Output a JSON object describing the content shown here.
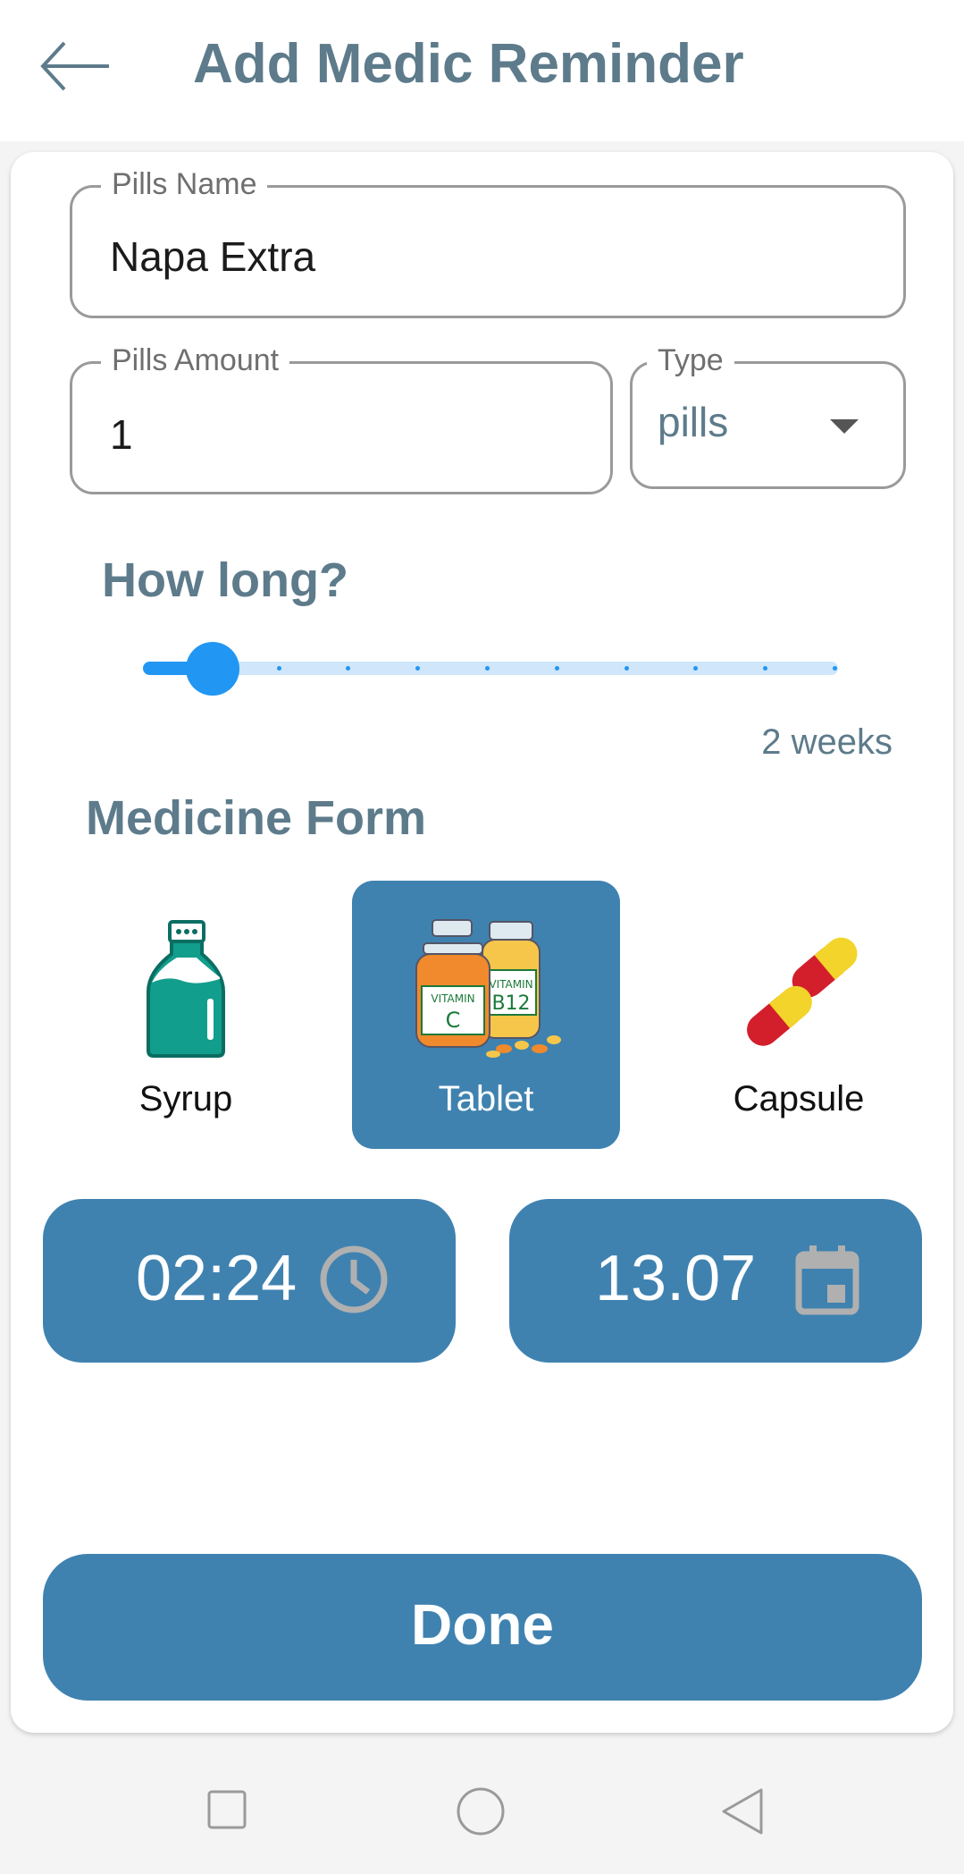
{
  "header": {
    "title": "Add Medic Reminder",
    "back_icon": "arrow-left-icon"
  },
  "pills_name": {
    "label": "Pills Name",
    "value": "Napa Extra"
  },
  "pills_amount": {
    "label": "Pills Amount",
    "value": "1"
  },
  "type": {
    "label": "Type",
    "value": "pills",
    "icon": "dropdown-arrow-icon"
  },
  "duration": {
    "heading": "How long?",
    "value_text": "2 weeks",
    "slider_fraction": 0.1,
    "slider_steps": 10
  },
  "medicine_form": {
    "heading": "Medicine Form",
    "selected": "Tablet",
    "options": [
      {
        "label": "Syrup",
        "icon": "syrup-bottle-icon"
      },
      {
        "label": "Tablet",
        "icon": "vitamin-bottles-icon"
      },
      {
        "label": "Capsule",
        "icon": "capsule-icon"
      }
    ]
  },
  "time": {
    "value": "02:24",
    "icon": "clock-icon"
  },
  "date": {
    "value": "13.07",
    "icon": "calendar-icon"
  },
  "done_label": "Done",
  "navbar": {
    "icons": [
      "square-recents-icon",
      "circle-home-icon",
      "triangle-back-icon"
    ]
  },
  "colors": {
    "accent": "#3f82b0",
    "title": "#5d7b8b",
    "slider": "#2196f3"
  }
}
